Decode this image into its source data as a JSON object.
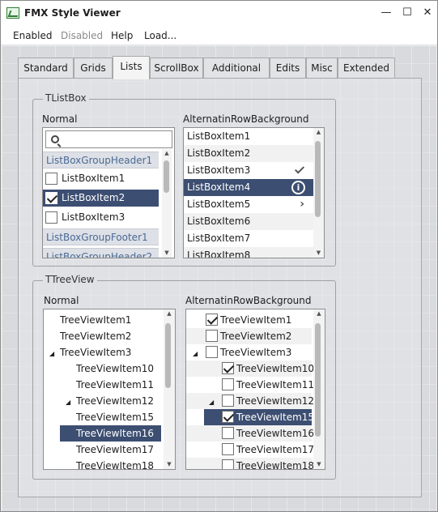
{
  "window": {
    "title": "FMX Style Viewer",
    "minimize_glyph": "—",
    "maximize_glyph": "☐",
    "close_glyph": "✕"
  },
  "menu": [
    "Enabled",
    "Disabled",
    "Help",
    "Load..."
  ],
  "tabs": [
    "Standard",
    "Grids",
    "Lists",
    "ScrollBox",
    "Additional",
    "Edits",
    "Misc",
    "Extended"
  ],
  "listbox_group": {
    "title": "TListBox",
    "normal": {
      "caption": "Normal",
      "search_placeholder": "",
      "items": [
        {
          "label": "ListBoxGroupHeader1",
          "kind": "header"
        },
        {
          "label": "ListBoxItem1",
          "checked": false
        },
        {
          "label": "ListBoxItem2",
          "checked": true,
          "selected": true
        },
        {
          "label": "ListBoxItem3",
          "checked": false
        },
        {
          "label": "ListBoxGroupFooter1",
          "kind": "header"
        },
        {
          "label": "ListBoxGroupHeader2",
          "kind": "header"
        }
      ]
    },
    "alternating": {
      "caption": "AlternatinRowBackground",
      "items": [
        {
          "label": "ListBoxItem1"
        },
        {
          "label": "ListBoxItem2"
        },
        {
          "label": "ListBoxItem3",
          "accessory": "checkmark-icon"
        },
        {
          "label": "ListBoxItem4",
          "accessory": "info-icon",
          "selected": true
        },
        {
          "label": "ListBoxItem5",
          "accessory": "more-icon"
        },
        {
          "label": "ListBoxItem6"
        },
        {
          "label": "ListBoxItem7"
        },
        {
          "label": "ListBoxItem8"
        }
      ]
    }
  },
  "treeview_group": {
    "title": "TTreeView",
    "normal": {
      "caption": "Normal",
      "items": [
        {
          "label": "TreeViewItem1",
          "level": 0
        },
        {
          "label": "TreeViewItem2",
          "level": 0
        },
        {
          "label": "TreeViewItem3",
          "level": 0,
          "expanded": true
        },
        {
          "label": "TreeViewItem10",
          "level": 1
        },
        {
          "label": "TreeViewItem11",
          "level": 1
        },
        {
          "label": "TreeViewItem12",
          "level": 1,
          "expanded": true
        },
        {
          "label": "TreeViewItem15",
          "level": 1
        },
        {
          "label": "TreeViewItem16",
          "level": 1,
          "selected": true
        },
        {
          "label": "TreeViewItem17",
          "level": 1
        },
        {
          "label": "TreeViewItem18",
          "level": 1
        }
      ]
    },
    "alternating": {
      "caption": "AlternatinRowBackground",
      "items": [
        {
          "label": "TreeViewItem1",
          "level": 0,
          "checked": true
        },
        {
          "label": "TreeViewItem2",
          "level": 0,
          "checked": false
        },
        {
          "label": "TreeViewItem3",
          "level": 0,
          "checked": false,
          "expanded": true
        },
        {
          "label": "TreeViewItem10",
          "level": 1,
          "checked": true
        },
        {
          "label": "TreeViewItem11",
          "level": 1,
          "checked": false
        },
        {
          "label": "TreeViewItem12",
          "level": 1,
          "checked": false,
          "expanded": true
        },
        {
          "label": "TreeViewItem15",
          "level": 1,
          "checked": true,
          "selected": true
        },
        {
          "label": "TreeViewItem16",
          "level": 1,
          "checked": false
        },
        {
          "label": "TreeViewItem17",
          "level": 1,
          "checked": false
        },
        {
          "label": "TreeViewItem18",
          "level": 1,
          "checked": false
        }
      ]
    }
  },
  "colors": {
    "selection": "#3c4e71",
    "group_header_text": "#4a6a95",
    "background": "#d8dadd"
  }
}
